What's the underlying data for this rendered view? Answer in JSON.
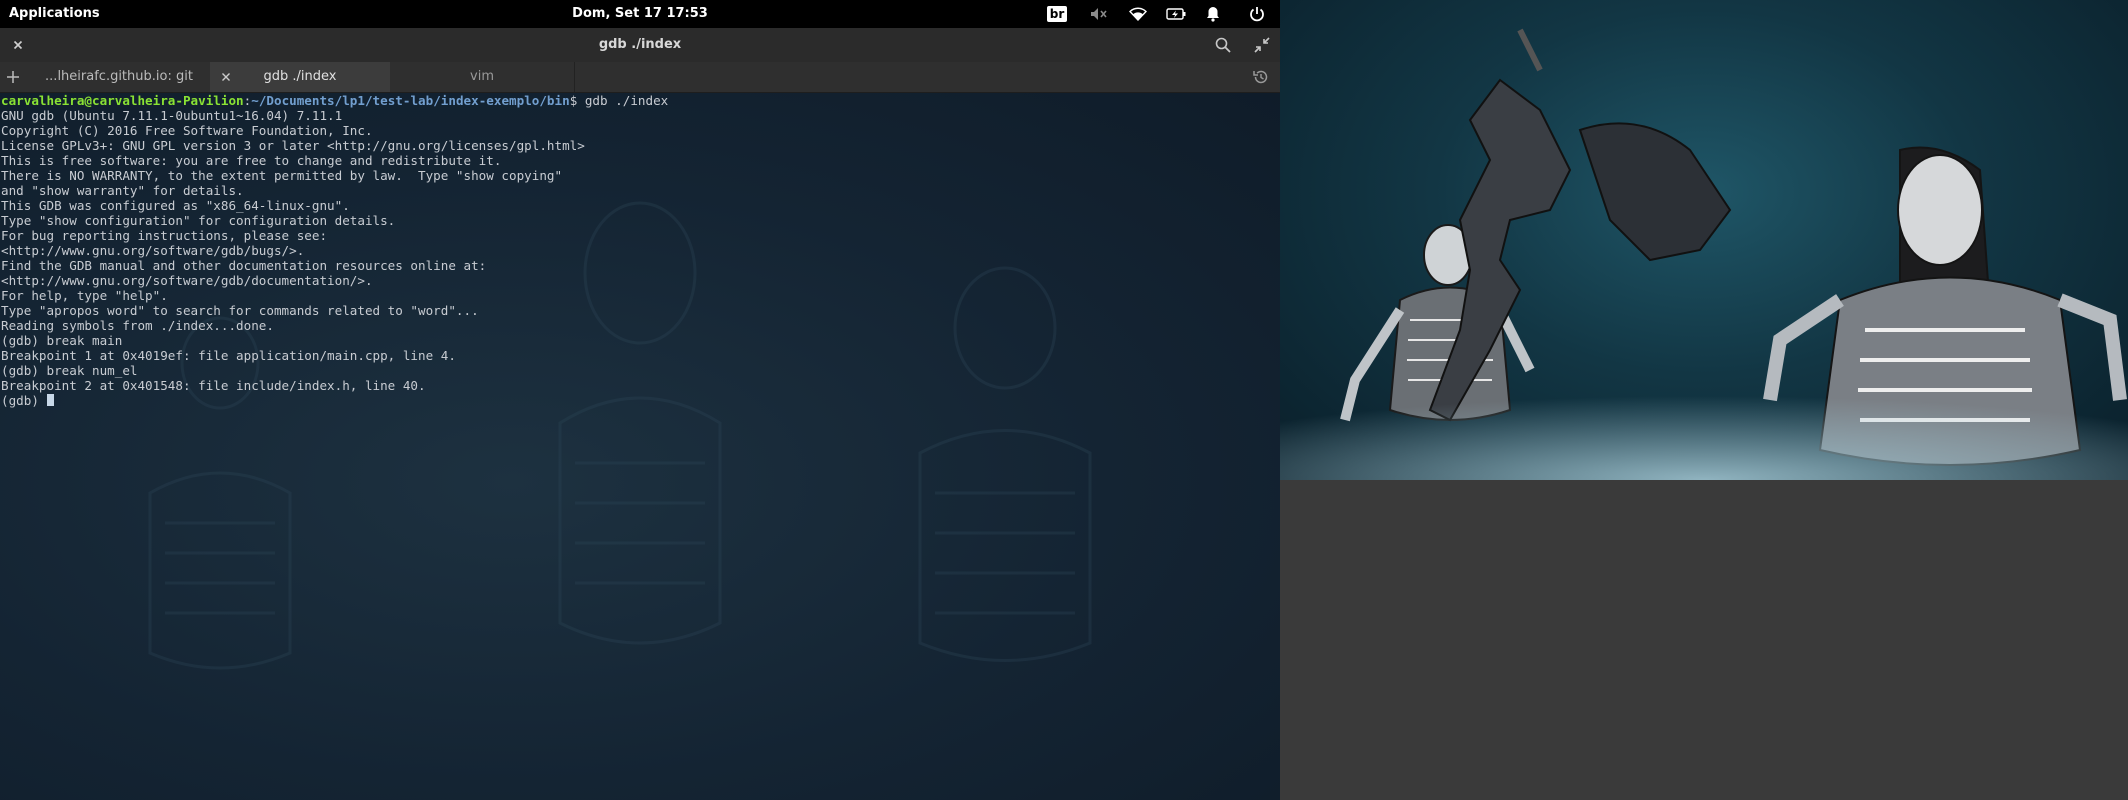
{
  "top_panel": {
    "applications_label": "Applications",
    "clock": "Dom, Set 17   17:53",
    "keyboard_layout": "br",
    "icons": [
      "volume-muted-icon",
      "wifi-icon",
      "battery-icon",
      "notification-bell-icon",
      "power-icon"
    ]
  },
  "window": {
    "title": "gdb ./index",
    "close_icon": "close-icon",
    "search_icon": "search-icon",
    "unmaximize_icon": "unmaximize-icon"
  },
  "tabs": [
    {
      "label": "...lheirafc.github.io: git",
      "active": false
    },
    {
      "label": "gdb ./index",
      "active": true
    },
    {
      "label": "vim",
      "active": false
    }
  ],
  "terminal": {
    "prompt_user": "carvalheira@carvalheira-Pavilion",
    "prompt_path": "~/Documents/lp1/test-lab/index-exemplo/bin",
    "command": "$ gdb ./index",
    "lines": [
      "GNU gdb (Ubuntu 7.11.1-0ubuntu1~16.04) 7.11.1",
      "Copyright (C) 2016 Free Software Foundation, Inc.",
      "License GPLv3+: GNU GPL version 3 or later <http://gnu.org/licenses/gpl.html>",
      "This is free software: you are free to change and redistribute it.",
      "There is NO WARRANTY, to the extent permitted by law.  Type \"show copying\"",
      "and \"show warranty\" for details.",
      "This GDB was configured as \"x86_64-linux-gnu\".",
      "Type \"show configuration\" for configuration details.",
      "For bug reporting instructions, please see:",
      "<http://www.gnu.org/software/gdb/bugs/>.",
      "Find the GDB manual and other documentation resources online at:",
      "<http://www.gnu.org/software/gdb/documentation/>.",
      "For help, type \"help\".",
      "Type \"apropos word\" to search for commands related to \"word\"...",
      "Reading symbols from ./index...done.",
      "(gdb) break main",
      "Breakpoint 1 at 0x4019ef: file application/main.cpp, line 4.",
      "(gdb) break num_el",
      "Breakpoint 2 at 0x401548: file include/index.h, line 40."
    ],
    "current_prompt": "(gdb) "
  },
  "colors": {
    "panel_bg": "#000000",
    "prompt_user": "#8ae234",
    "prompt_path": "#729fcf",
    "terminal_text": "#c8ccd2",
    "desktop_bg": "#3a3a3a"
  }
}
